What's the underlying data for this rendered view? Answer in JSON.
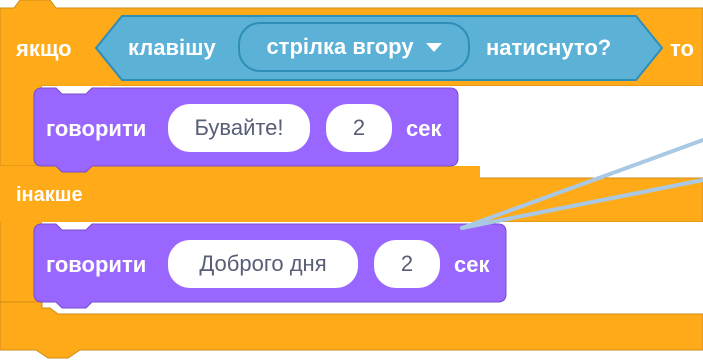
{
  "blocks": {
    "if_else": {
      "if_label": "якщо",
      "then_label": "то",
      "else_label": "інакше",
      "color": "#FFAB19",
      "border": "#CF8B17"
    },
    "condition": {
      "pre_label": "клавішу",
      "key_value": "стрілка вгору",
      "post_label": "натиснуто?",
      "color": "#5CB1D6"
    },
    "say_top": {
      "verb": "говорити",
      "message": "Бувайте!",
      "seconds": "2",
      "unit": "сек"
    },
    "say_bottom": {
      "verb": "говорити",
      "message": "Доброго дня",
      "seconds": "2",
      "unit": "сек"
    },
    "looks_color": "#9966FF",
    "pointer_color": "#A9C8E4"
  }
}
